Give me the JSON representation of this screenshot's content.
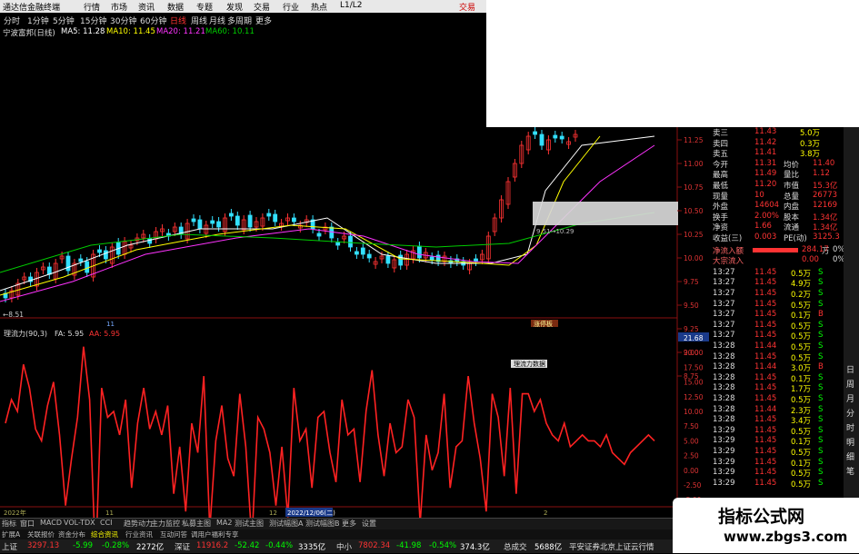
{
  "titlebar": {
    "app": "通达信金融终端",
    "menus": [
      "行情",
      "市场",
      "资讯",
      "数据",
      "专题",
      "发现",
      "交易",
      "行业",
      "热点",
      "L1/L2"
    ],
    "trade": "交易"
  },
  "timeframes": [
    "分时",
    "1分钟",
    "5分钟",
    "15分钟",
    "30分钟",
    "60分钟",
    "日线",
    "周线",
    "月线",
    "多周期",
    "更多"
  ],
  "ma_line": {
    "name": "宁波富邦(日线)",
    "ma5": "MA5: 11.28",
    "ma10": "MA10: 11.45",
    "ma20": "MA20: 11.21",
    "ma60": "MA60: 10.11"
  },
  "colors": {
    "ma5": "#ffffff",
    "ma10": "#ffff00",
    "ma20": "#ff33ff",
    "ma60": "#00cc00",
    "indicator": "#ff2222",
    "up": "#ff3333",
    "down": "#33e0ff"
  },
  "price_axis": [
    "11.25",
    "11.00",
    "10.75",
    "10.50",
    "10.25",
    "10.00",
    "9.75",
    "9.50",
    "9.25",
    "9.00",
    "8.75"
  ],
  "low_label": "←8.51",
  "overlay_label": "9.51→10.29",
  "kline_label": "涨停板",
  "x_marker": "11",
  "indicator": {
    "name": "理流力(90,3)",
    "fa": "FA: 5.95",
    "aa": "AA: 5.95",
    "axis": [
      "21.68",
      "20.00",
      "17.50",
      "15.00",
      "12.50",
      "10.00",
      "7.50",
      "5.00",
      "2.50",
      "0.00",
      "-2.50",
      "-5.00",
      "-7.50"
    ],
    "tooltip": "理流力数据"
  },
  "indicator_values": [
    8,
    12,
    10,
    18,
    14,
    7,
    5,
    11,
    15,
    6,
    -6,
    2,
    9,
    21,
    12,
    -16,
    14,
    9,
    10,
    6,
    12,
    -3,
    8,
    14,
    7,
    10,
    6,
    11,
    -4,
    4,
    -7,
    8,
    3,
    16,
    -10,
    5,
    11,
    2,
    -1,
    13,
    4,
    -12,
    9,
    7,
    3,
    -6,
    4,
    -8,
    14,
    5,
    7,
    -3,
    9,
    10,
    3,
    -2,
    12,
    6,
    7,
    -2,
    10,
    17,
    6,
    -1,
    8,
    3,
    4,
    12,
    9,
    -9,
    6,
    0,
    3,
    13,
    -3,
    4,
    5,
    16,
    8,
    2,
    -7,
    13,
    9,
    -1,
    14,
    -4,
    13,
    13,
    10,
    12,
    8,
    6,
    5,
    8,
    4,
    5,
    6,
    5,
    5,
    4,
    6,
    3,
    2,
    1,
    3,
    4,
    5,
    6,
    5
  ],
  "dates": {
    "left": "2022年",
    "mid": "2022/12/06(二)",
    "m1": "11",
    "m2": "12",
    "m3": "2"
  },
  "quote": {
    "top": [
      [
        "卖三",
        "11.43",
        "5.0万"
      ],
      [
        "卖四",
        "11.42",
        "0.3万"
      ],
      [
        "卖五",
        "11.41",
        "3.8万"
      ]
    ],
    "stats": [
      [
        "今开",
        "11.31",
        "均价",
        "11.40"
      ],
      [
        "最高",
        "11.49",
        "量比",
        "1.12"
      ],
      [
        "最低",
        "11.20",
        "市值",
        "15.3亿"
      ],
      [
        "现量",
        "10",
        "总量",
        "26773"
      ],
      [
        "外盘",
        "14604",
        "内盘",
        "12169"
      ],
      [
        "换手",
        "2.00%",
        "股本",
        "1.34亿"
      ],
      [
        "净资",
        "1.66",
        "流通",
        "1.34亿"
      ],
      [
        "收益(三)",
        "0.003",
        "PE(动)",
        "3125.3"
      ]
    ],
    "flow": [
      [
        "净流入额",
        "284.17",
        "万",
        "0%"
      ],
      [
        "大宗流入",
        "0.00",
        "",
        "0%"
      ]
    ],
    "ticks": [
      [
        "13:27",
        "11.45",
        "0.5万",
        "S"
      ],
      [
        "13:27",
        "11.45",
        "4.9万",
        "S"
      ],
      [
        "13:27",
        "11.45",
        "0.2万",
        "S"
      ],
      [
        "13:27",
        "11.45",
        "0.5万",
        "S"
      ],
      [
        "13:27",
        "11.45",
        "0.1万",
        "B"
      ],
      [
        "13:27",
        "11.45",
        "0.5万",
        "S"
      ],
      [
        "13:27",
        "11.45",
        "0.5万",
        "S"
      ],
      [
        "13:28",
        "11.44",
        "0.5万",
        "S"
      ],
      [
        "13:28",
        "11.45",
        "0.5万",
        "S"
      ],
      [
        "13:28",
        "11.44",
        "3.0万",
        "B"
      ],
      [
        "13:28",
        "11.45",
        "0.1万",
        "S"
      ],
      [
        "13:28",
        "11.45",
        "1.7万",
        "S"
      ],
      [
        "13:28",
        "11.45",
        "0.5万",
        "S"
      ],
      [
        "13:28",
        "11.44",
        "2.3万",
        "S"
      ],
      [
        "13:28",
        "11.45",
        "3.4万",
        "S"
      ],
      [
        "13:29",
        "11.45",
        "0.5万",
        "S"
      ],
      [
        "13:29",
        "11.45",
        "0.1万",
        "S"
      ],
      [
        "13:29",
        "11.45",
        "0.5万",
        "S"
      ],
      [
        "13:29",
        "11.45",
        "0.1万",
        "S"
      ],
      [
        "13:29",
        "11.45",
        "0.5万",
        "S"
      ],
      [
        "13:29",
        "11.45",
        "0.5万",
        "S"
      ]
    ]
  },
  "tabs": [
    "指标",
    "窗口",
    "MACD",
    "VOL-TDX",
    "CCI",
    "趋势动力",
    "主力监控",
    "私募主图",
    "MA2",
    "测试主图",
    "测试幅图A",
    "测试幅图B",
    "更多",
    "设置"
  ],
  "tabs2": [
    "扩展A",
    "关联报价",
    "资金分布",
    "综合资讯",
    "行业资讯",
    "互动问答",
    "调用户福利专享"
  ],
  "status": {
    "sh_label": "上证",
    "sh": "3297.13",
    "sh_chg": "-5.99",
    "sh_pct": "-0.28%",
    "sh_amt": "2272亿",
    "sz_label": "深证",
    "sz": "11916.2",
    "sz_chg": "-52.42",
    "sz_pct": "-0.44%",
    "sz_amt": "3335亿",
    "zx_label": "中小",
    "zx": "7802.34",
    "zx_chg": "-41.98",
    "zx_pct": "-0.54%",
    "zx_amt": "374.3亿",
    "total_label": "总成交",
    "total": "5688亿",
    "broker": "平安证券北京上证云行情"
  },
  "right_tabs": [
    "日",
    "周",
    "月",
    "分",
    "时",
    "明",
    "细",
    "笔"
  ],
  "watermark": {
    "title": "指标公式网",
    "url": "www.zbgs3.com"
  }
}
